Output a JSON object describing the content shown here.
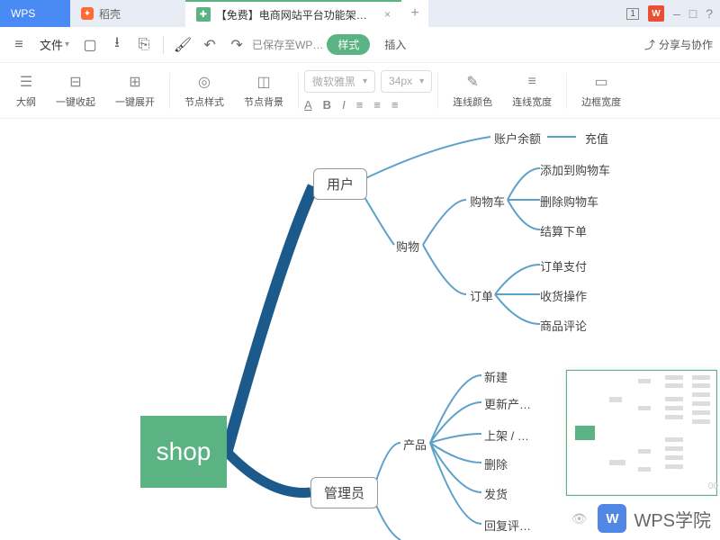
{
  "titlebar": {
    "wps": "WPS",
    "daoke": "稻壳",
    "doc_title": "【免费】电商网站平台功能架构图",
    "close": "×",
    "add": "+",
    "count": "1",
    "wps_logo": "W",
    "min": "–",
    "max": "□",
    "q": "?"
  },
  "menubar": {
    "file": "文件",
    "save_status": "已保存至WP…",
    "style": "样式",
    "insert": "插入",
    "share": "分享与协作"
  },
  "toolbar": {
    "outline": "大纲",
    "collapse": "一键收起",
    "expand": "一键展开",
    "node_style": "节点样式",
    "node_bg": "节点背景",
    "font": "微软雅黑",
    "size": "34px",
    "line_color": "连线颜色",
    "line_width": "连线宽度",
    "border_width": "边框宽度"
  },
  "mindmap": {
    "root": "shop",
    "l1": {
      "user": "用户",
      "admin": "管理员"
    },
    "user": {
      "balance": "账户余额",
      "balance_leaf": "充值",
      "shopping": "购物",
      "cart": "购物车",
      "cart_leaves": [
        "添加到购物车",
        "删除购物车",
        "结算下单"
      ],
      "order": "订单",
      "order_leaves": [
        "订单支付",
        "收货操作",
        "商品评论"
      ]
    },
    "admin": {
      "product": "产品",
      "product_leaves": [
        "新建",
        "更新产…",
        "上架 / …",
        "删除",
        "发货",
        "回复评…"
      ]
    }
  },
  "watermark": {
    "icon": "W",
    "text": "WPS学院"
  },
  "zoom": "00"
}
